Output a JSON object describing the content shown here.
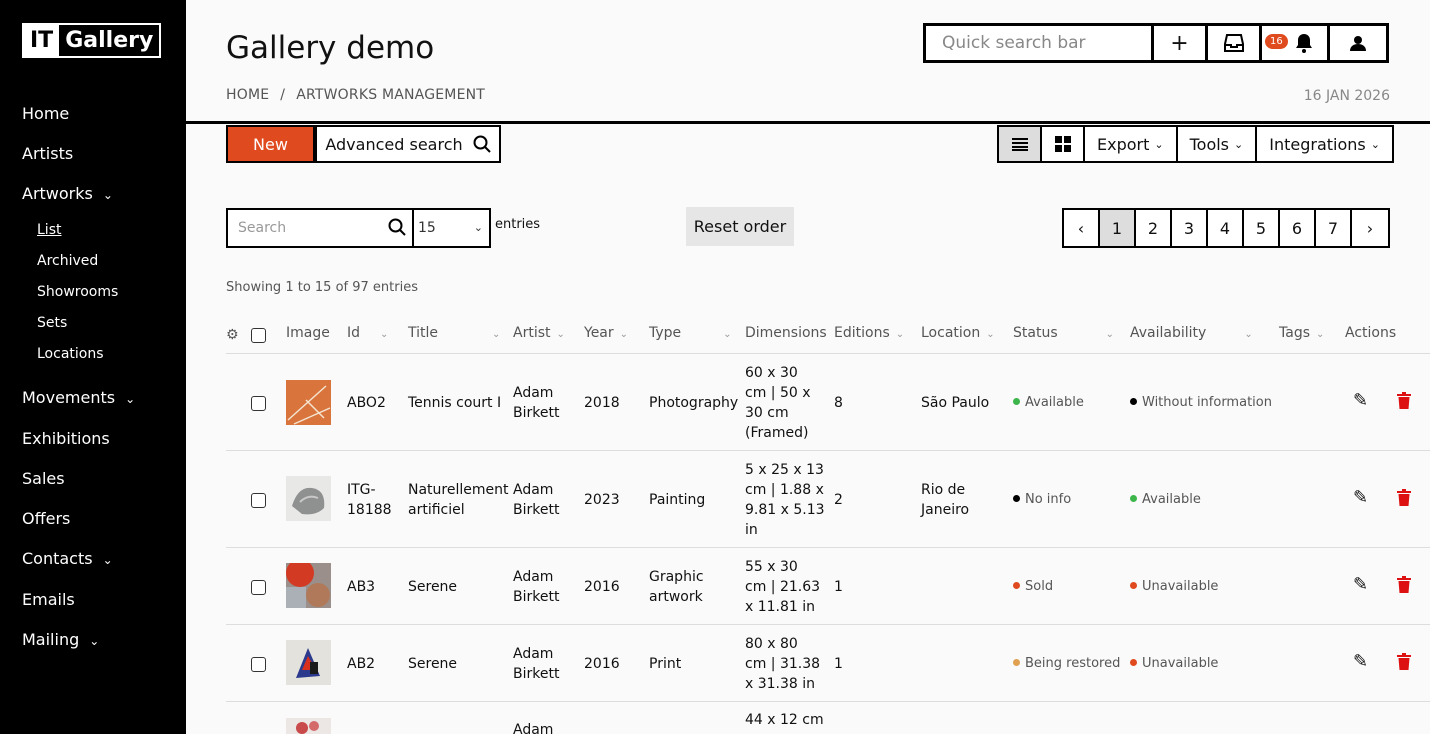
{
  "brand": {
    "logo_it": "IT",
    "logo_gallery": "Gallery"
  },
  "sidebar": {
    "home": "Home",
    "artists": "Artists",
    "artworks": "Artworks",
    "artworks_sub": [
      "List",
      "Archived",
      "Showrooms",
      "Sets",
      "Locations"
    ],
    "movements": "Movements",
    "exhibitions": "Exhibitions",
    "sales": "Sales",
    "offers": "Offers",
    "contacts": "Contacts",
    "emails": "Emails",
    "mailing": "Mailing"
  },
  "header": {
    "title": "Gallery demo",
    "breadcrumb": [
      "HOME",
      "ARTWORKS MANAGEMENT"
    ],
    "breadcrumb_sep": "/",
    "date": "16 JAN 2026",
    "quick_search_placeholder": "Quick search bar",
    "notifications_count": "16"
  },
  "toolbar": {
    "new_label": "New",
    "advanced_search_label": "Advanced search",
    "export_label": "Export",
    "tools_label": "Tools",
    "integrations_label": "Integrations"
  },
  "list_controls": {
    "search_placeholder": "Search",
    "entries_value": "15",
    "entries_label": "entries",
    "reset_order_label": "Reset order",
    "pages": [
      "1",
      "2",
      "3",
      "4",
      "5",
      "6",
      "7"
    ],
    "active_page": "1",
    "showing": "Showing 1 to 15 of 97 entries"
  },
  "table": {
    "headers": {
      "image": "Image",
      "id": "Id",
      "title": "Title",
      "artist": "Artist",
      "year": "Year",
      "type": "Type",
      "dimensions": "Dimensions",
      "editions": "Editions",
      "location": "Location",
      "status": "Status",
      "availability": "Availability",
      "tags": "Tags",
      "actions": "Actions"
    },
    "rows": [
      {
        "id": "ABO2",
        "title": "Tennis court I",
        "artist": [
          "Adam",
          "Birkett"
        ],
        "year": "2018",
        "type": [
          "Photography"
        ],
        "dimensions": [
          "60 x 30",
          "cm | 50 x",
          "30 cm",
          "(Framed)"
        ],
        "editions": "8",
        "location": [
          "São Paulo"
        ],
        "status": "Available",
        "status_color": "#3cb54a",
        "availability": "Without information",
        "availability_color": "#000000"
      },
      {
        "id": [
          "ITG-",
          "18188"
        ],
        "title": [
          "Naturellement",
          "artificiel"
        ],
        "artist": [
          "Adam",
          "Birkett"
        ],
        "year": "2023",
        "type": [
          "Painting"
        ],
        "dimensions": [
          "5 x 25 x 13",
          "cm | 1.88 x",
          "9.81 x 5.13",
          "in"
        ],
        "editions": "2",
        "location": [
          "Rio de",
          "Janeiro"
        ],
        "status": "No info",
        "status_color": "#000000",
        "availability": "Available",
        "availability_color": "#3cb54a"
      },
      {
        "id": "AB3",
        "title": "Serene",
        "artist": [
          "Adam",
          "Birkett"
        ],
        "year": "2016",
        "type": [
          "Graphic",
          "artwork"
        ],
        "dimensions": [
          "55 x 30",
          "cm | 21.63",
          "x 11.81 in"
        ],
        "editions": "1",
        "location": [],
        "status": "Sold",
        "status_color": "#e04a1f",
        "availability": "Unavailable",
        "availability_color": "#e04a1f"
      },
      {
        "id": "AB2",
        "title": "Serene",
        "artist": [
          "Adam",
          "Birkett"
        ],
        "year": "2016",
        "type": [
          "Print"
        ],
        "dimensions": [
          "80 x 80",
          "cm | 31.38",
          "x 31.38 in"
        ],
        "editions": "1",
        "location": [],
        "status": "Being restored",
        "status_color": "#e0a050",
        "availability": "Unavailable",
        "availability_color": "#e04a1f"
      },
      {
        "id": "",
        "title": "",
        "artist": [
          "Adam"
        ],
        "year": "",
        "type": [],
        "dimensions": [
          "44 x 12 cm"
        ],
        "editions": "",
        "location": [],
        "status": "",
        "status_color": "",
        "availability": "",
        "availability_color": ""
      }
    ]
  }
}
